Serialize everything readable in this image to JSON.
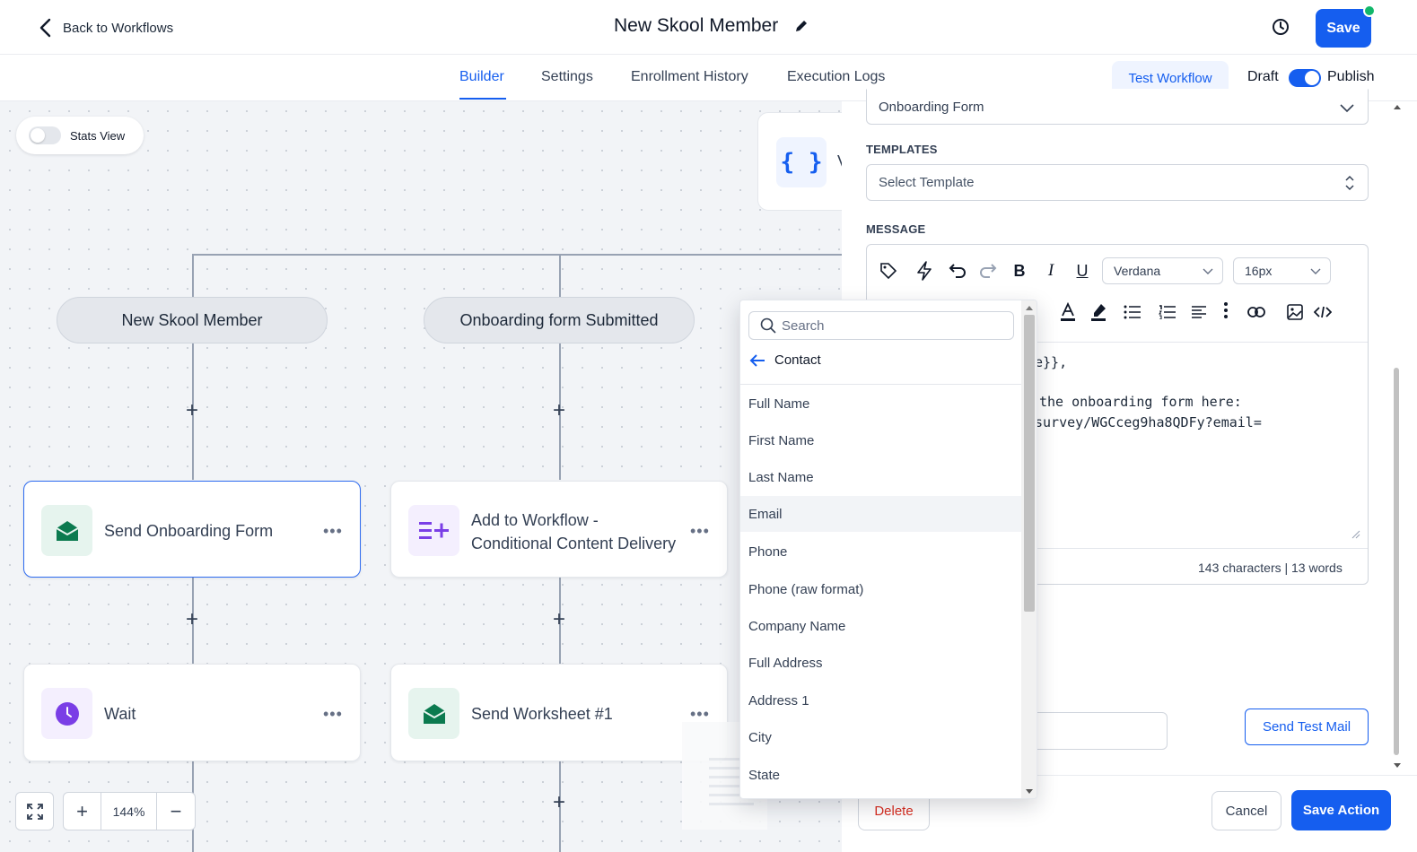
{
  "header": {
    "back_label": "Back to Workflows",
    "workflow_title": "New Skool Member",
    "save_label": "Save"
  },
  "tabs": [
    {
      "label": "Builder",
      "active": true
    },
    {
      "label": "Settings",
      "active": false
    },
    {
      "label": "Enrollment History",
      "active": false
    },
    {
      "label": "Execution Logs",
      "active": false
    }
  ],
  "toolbar_right": {
    "test_workflow": "Test Workflow",
    "draft": "Draft",
    "publish": "Publish",
    "published": true
  },
  "canvas": {
    "stats_view_label": "Stats View",
    "stats_view_on": false,
    "zoom_level": "144%",
    "variable_card_icon": "{ }",
    "variable_card_partial": "V",
    "triggers": [
      "New Skool Member",
      "Onboarding form Submitted"
    ],
    "nodes": [
      {
        "label_lines": [
          "Send Onboarding Form"
        ],
        "icon": "envelope-open-icon",
        "selected": true
      },
      {
        "label_lines": [
          "Add to Workflow -",
          "Conditional Content Delivery"
        ],
        "icon": "list-plus-icon",
        "selected": false
      },
      {
        "label_lines": [
          "Wait"
        ],
        "icon": "clock-icon",
        "selected": false
      },
      {
        "label_lines": [
          "Send Worksheet #1"
        ],
        "icon": "envelope-open-icon",
        "selected": false
      }
    ],
    "colors": {
      "email_icon_bg": "#e6f4ee",
      "email_icon": "#0b7a4f",
      "workflow_icon_bg": "#f4effe",
      "workflow_icon": "#7a3ee6",
      "wait_icon": "#7a3ee6"
    }
  },
  "panel": {
    "form_select_value": "Onboarding Form",
    "templates_label": "TEMPLATES",
    "template_placeholder": "Select Template",
    "message_label": "MESSAGE",
    "font_family": "Verdana",
    "font_size": "16px",
    "message_fragments": [
      "e}},",
      "the onboarding form here:",
      "survey/WGCceg9ha8QDFy?email="
    ],
    "counter": "143 characters | 13 words",
    "send_test_label": "Send Test Mail",
    "delete_label": "Delete",
    "cancel_label": "Cancel",
    "save_action_label": "Save Action"
  },
  "dropdown": {
    "search_placeholder": "Search",
    "back_label": "Contact",
    "items": [
      "Full Name",
      "First Name",
      "Last Name",
      "Email",
      "Phone",
      "Phone (raw format)",
      "Company Name",
      "Full Address",
      "Address 1",
      "City",
      "State"
    ],
    "hovered_item": "Email"
  }
}
